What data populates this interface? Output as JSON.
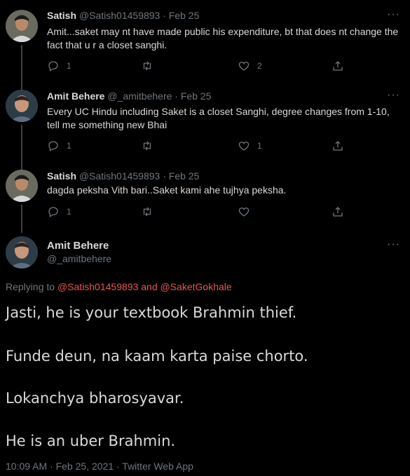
{
  "tweets": [
    {
      "name": "Satish",
      "handle": "@Satish01459893",
      "date": "Feb 25",
      "text": "Amit...saket may nt have made public his expenditure, bt that does nt change the fact that u r a closet sanghi.",
      "reply_count": "1",
      "like_count": "2"
    },
    {
      "name": "Amit Behere",
      "handle": "@_amitbehere",
      "date": "Feb 25",
      "text": "Every UC Hindu including Saket is a closet Sanghi, degree changes from 1-10, tell me something new Bhai",
      "reply_count": "1",
      "like_count": "1"
    },
    {
      "name": "Satish",
      "handle": "@Satish01459893",
      "date": "Feb 25",
      "text": "dagda peksha Vith bari..Saket kami ahe tujhya peksha.",
      "reply_count": "1",
      "like_count": ""
    }
  ],
  "sep": " · ",
  "more": "···",
  "main": {
    "name": "Amit Behere",
    "handle": "@_amitbehere",
    "replying_prefix": "Replying to ",
    "mention1": "@Satish01459893",
    "and": " and ",
    "mention2": "@SaketGokhale",
    "lines": [
      "Jasti, he is your textbook Brahmin thief.",
      "Funde deun, na kaam karta paise chorto.",
      "Lokanchya bharosyavar.",
      "He is an uber Brahmin."
    ],
    "meta": "10:09 AM · Feb 25, 2021 · Twitter Web App"
  },
  "icons": [
    "reply-icon",
    "retweet-icon",
    "like-icon",
    "share-icon",
    "more-icon"
  ]
}
